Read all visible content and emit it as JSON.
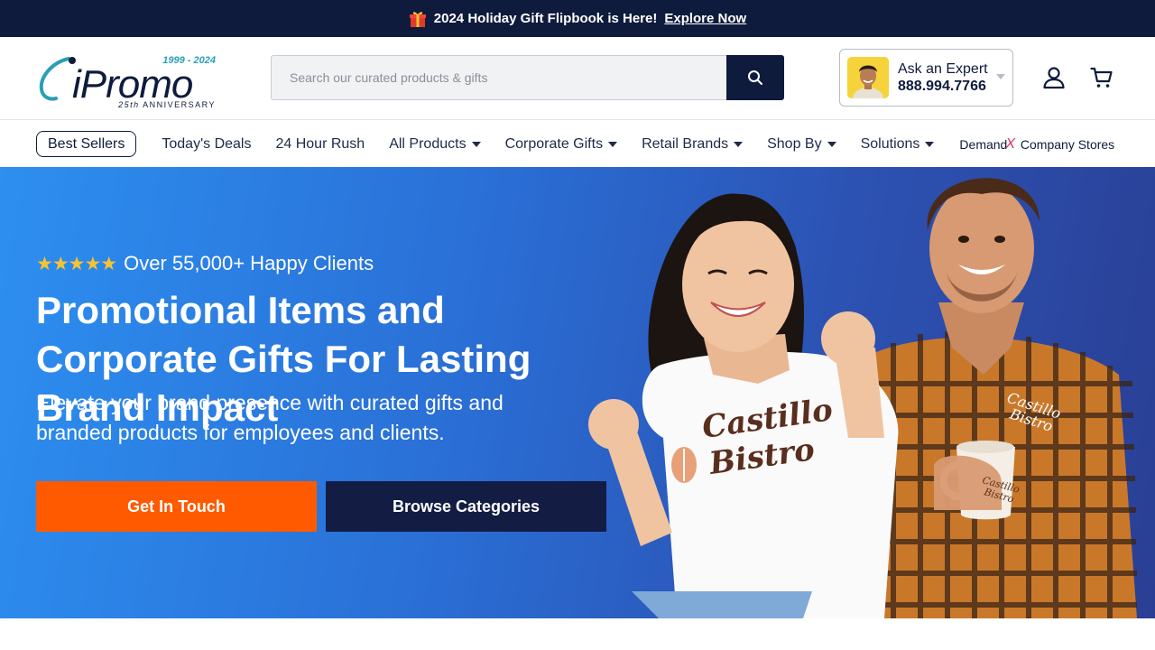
{
  "promo": {
    "text": "2024 Holiday Gift Flipbook is Here!",
    "link": "Explore Now"
  },
  "logo": {
    "years": "1999 - 2024",
    "word": "iPromo",
    "anniversary_num": "25th",
    "anniversary_text": "ANNIVERSARY"
  },
  "search": {
    "placeholder": "Search our curated products & gifts"
  },
  "expert": {
    "label": "Ask an Expert",
    "phone": "888.994.7766"
  },
  "nav": {
    "best_sellers": "Best Sellers",
    "items": [
      {
        "label": "Today's Deals"
      },
      {
        "label": "24 Hour Rush"
      },
      {
        "label": "All Products"
      },
      {
        "label": "Corporate Gifts"
      },
      {
        "label": "Retail Brands"
      },
      {
        "label": "Shop By"
      },
      {
        "label": "Solutions"
      }
    ],
    "demand_left": "Demand",
    "demand_x": "X",
    "demand_right": "Company Stores"
  },
  "hero": {
    "stars": "★★★★★",
    "rating_text": "Over 55,000+ Happy Clients",
    "title": "Promotional Items and Corporate Gifts For Lasting Brand Impact",
    "subtitle": "Elevate your brand presence with curated gifts and branded products for employees and clients.",
    "cta_primary": "Get In Touch",
    "cta_secondary": "Browse Categories",
    "shirt_brand_line1": "Castillo",
    "shirt_brand_line2": "Bistro"
  },
  "colors": {
    "navy": "#0f1b3d",
    "orange": "#ff5a00",
    "hero_blue": "#2a6fd6",
    "star": "#f7c331",
    "teal": "#2a9fb5"
  }
}
